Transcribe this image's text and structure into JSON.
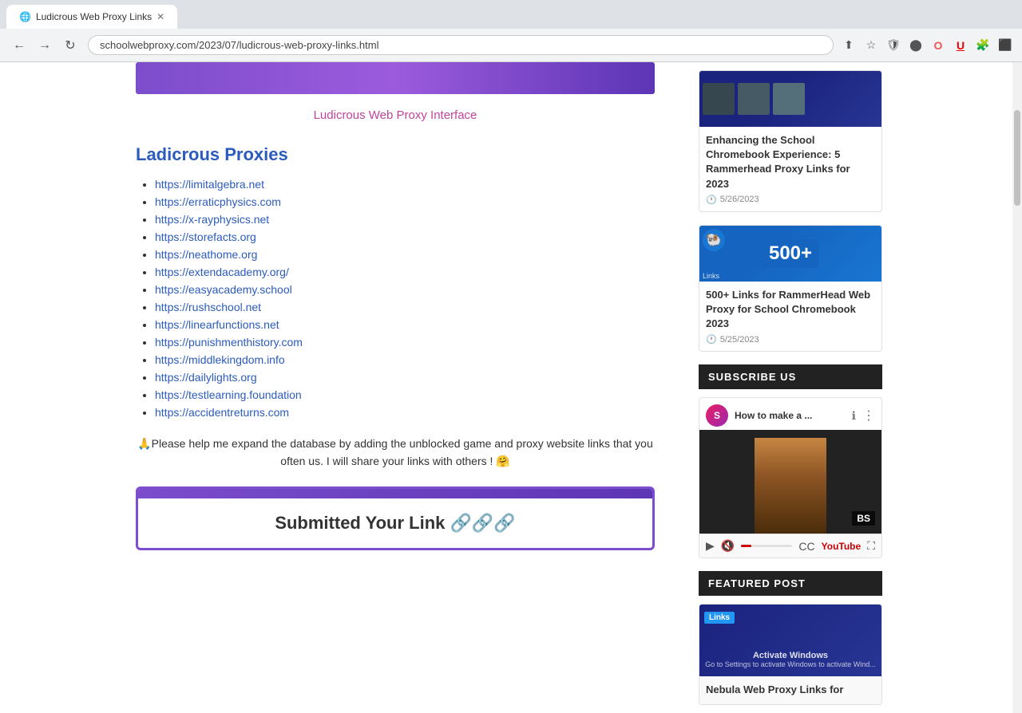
{
  "browser": {
    "url": "schoolwebproxy.com/2023/07/ludicrous-web-proxy-links.html",
    "tab_title": "Ludicrous Web Proxy Links"
  },
  "page": {
    "banner_text": "Ludicrous Web Proxy Interface",
    "main_heading": "Ladicrous Proxies",
    "proxy_links": [
      "https://limitalgebra.net",
      "https://erraticphysics.com",
      "https://x-rayphysics.net",
      "https://storefacts.org",
      "https://neathome.org",
      "https://extendacademy.org/",
      "https://easyacademy.school",
      "https://rushschool.net",
      "https://linearfunctions.net",
      "https://punishmenthistory.com",
      "https://middlekingdom.info",
      "https://dailylights.org",
      "https://testlearning.foundation",
      "https://accidentreturns.com"
    ],
    "help_text": "🙏Please help me expand the database by adding the unblocked game and proxy website links that you often us.  I will share your links with others ! 🤗",
    "submit_box_title": "Submitted Your Link 🔗🔗🔗"
  },
  "sidebar": {
    "subscribe_label": "SUBSCRIBE US",
    "featured_label": "FEATURED POST",
    "cards": [
      {
        "id": "card1",
        "title": "Enhancing the School Chromebook Experience: 5 Rammerhead Proxy Links for 2023",
        "date": "5/26/2023",
        "thumb_type": "dark_blue"
      },
      {
        "id": "card2",
        "title": "500+ Links for RammerHead Web Proxy for School Chromebook 2023",
        "date": "5/25/2023",
        "thumb_type": "blue_500"
      }
    ],
    "youtube": {
      "title": "How to make a ...",
      "channel_initial": "S",
      "bs_badge": "BS",
      "progress_percent": 20
    },
    "featured_card": {
      "badge": "Links",
      "activate_title": "Activate Windows",
      "activate_sub": "Go to Settings to activate Windows to activate Wind...",
      "title": "Nebula Web Proxy Links for"
    }
  }
}
